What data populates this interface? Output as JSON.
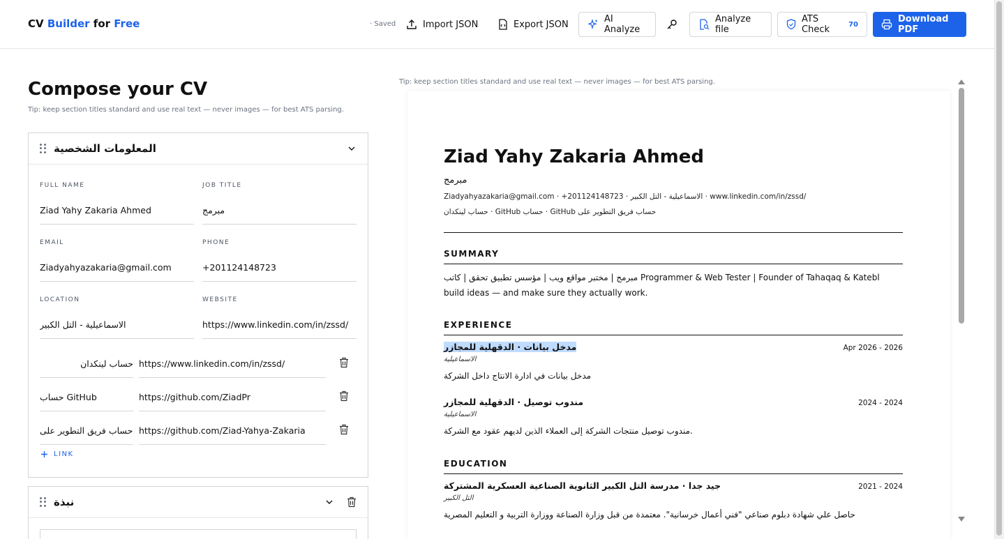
{
  "header": {
    "brand": {
      "part1": "CV",
      "part2": "Builder",
      "part3": "for",
      "part4": "Free"
    },
    "saved": "· Saved",
    "import": "Import JSON",
    "export": "Export JSON",
    "ai": "AI Analyze",
    "analyze_file": "Analyze file",
    "ats": "ATS Check",
    "ats_score": "70",
    "download": "Download PDF"
  },
  "editor": {
    "title": "Compose your CV",
    "tip": "Tip: keep section titles standard and use real text — never images — for best ATS parsing.",
    "personal": {
      "heading": "المعلومات الشخصية",
      "labels": {
        "name": "FULL NAME",
        "job": "JOB TITLE",
        "email": "EMAIL",
        "phone": "PHONE",
        "location": "LOCATION",
        "website": "WEBSITE"
      },
      "values": {
        "name": "Ziad Yahy Zakaria Ahmed",
        "job": "مبرمج",
        "email": "Ziadyahyazakaria@gmail.com",
        "phone": "+201124148723",
        "location": "الاسماعيلية - التل الكبير",
        "website": "https://www.linkedin.com/in/zssd/"
      },
      "links": [
        {
          "label": "حساب لينكدان",
          "url": "https://www.linkedin.com/in/zssd/"
        },
        {
          "label": "حساب GitHub",
          "url": "https://github.com/ZiadPr"
        },
        {
          "label": "حساب فريق التطوير على",
          "url": "https://github.com/Ziad-Yahya-Zakaria"
        }
      ],
      "add_link": "LINK"
    },
    "summary_card": {
      "heading": "نبذة"
    }
  },
  "preview": {
    "tip": "Tip: keep section titles standard and use real text — never images — for best ATS parsing.",
    "name": "Ziad Yahy Zakaria Ahmed",
    "job": "مبرمج",
    "contact1": "Ziadyahyazakaria@gmail.com · +201124148723 · الاسماعيلية - التل الكبير · www.linkedin.com/in/zssd/",
    "contact2": "حساب لينكدان · GitHub حساب · GitHub حساب فريق التطوير على",
    "summary_heading": "SUMMARY",
    "summary_text": "مبرمج | مختبر مواقع ويب | مؤسس تطبيق تحقق | كاتب Programmer & Web Tester | Founder of Tahaqaq & Katebl build ideas — and make sure they actually work.",
    "experience_heading": "EXPERIENCE",
    "experience": [
      {
        "title": "مدخل بيانات · الدقهلية للمجازر",
        "date": "Apr 2026 - 2026",
        "location": "الاسماعيلية",
        "desc": "مدخل بيانات في ادارة الانتاج داخل الشركة"
      },
      {
        "title": "مندوب توصيل · الدقهلية للمجازر",
        "date": "2024 - 2024",
        "location": "الاسماعيلية",
        "desc": "مندوب توصيل منتجات الشركة إلى العملاء الذين لديهم عقود مع الشركة."
      }
    ],
    "education_heading": "EDUCATION",
    "education": [
      {
        "title": "جيد جدا · مدرسة التل الكبير الثانوية الصناعية العسكرية المشتركة",
        "date": "2021 - 2024",
        "location": "التل الكبير",
        "desc": "حاصل علي شهادة دبلوم صناعي \"فني أعمال خرسانية\". معتمدة من قبل وزارة الصناعة ووزارة التربية و التعليم المصرية"
      }
    ]
  }
}
